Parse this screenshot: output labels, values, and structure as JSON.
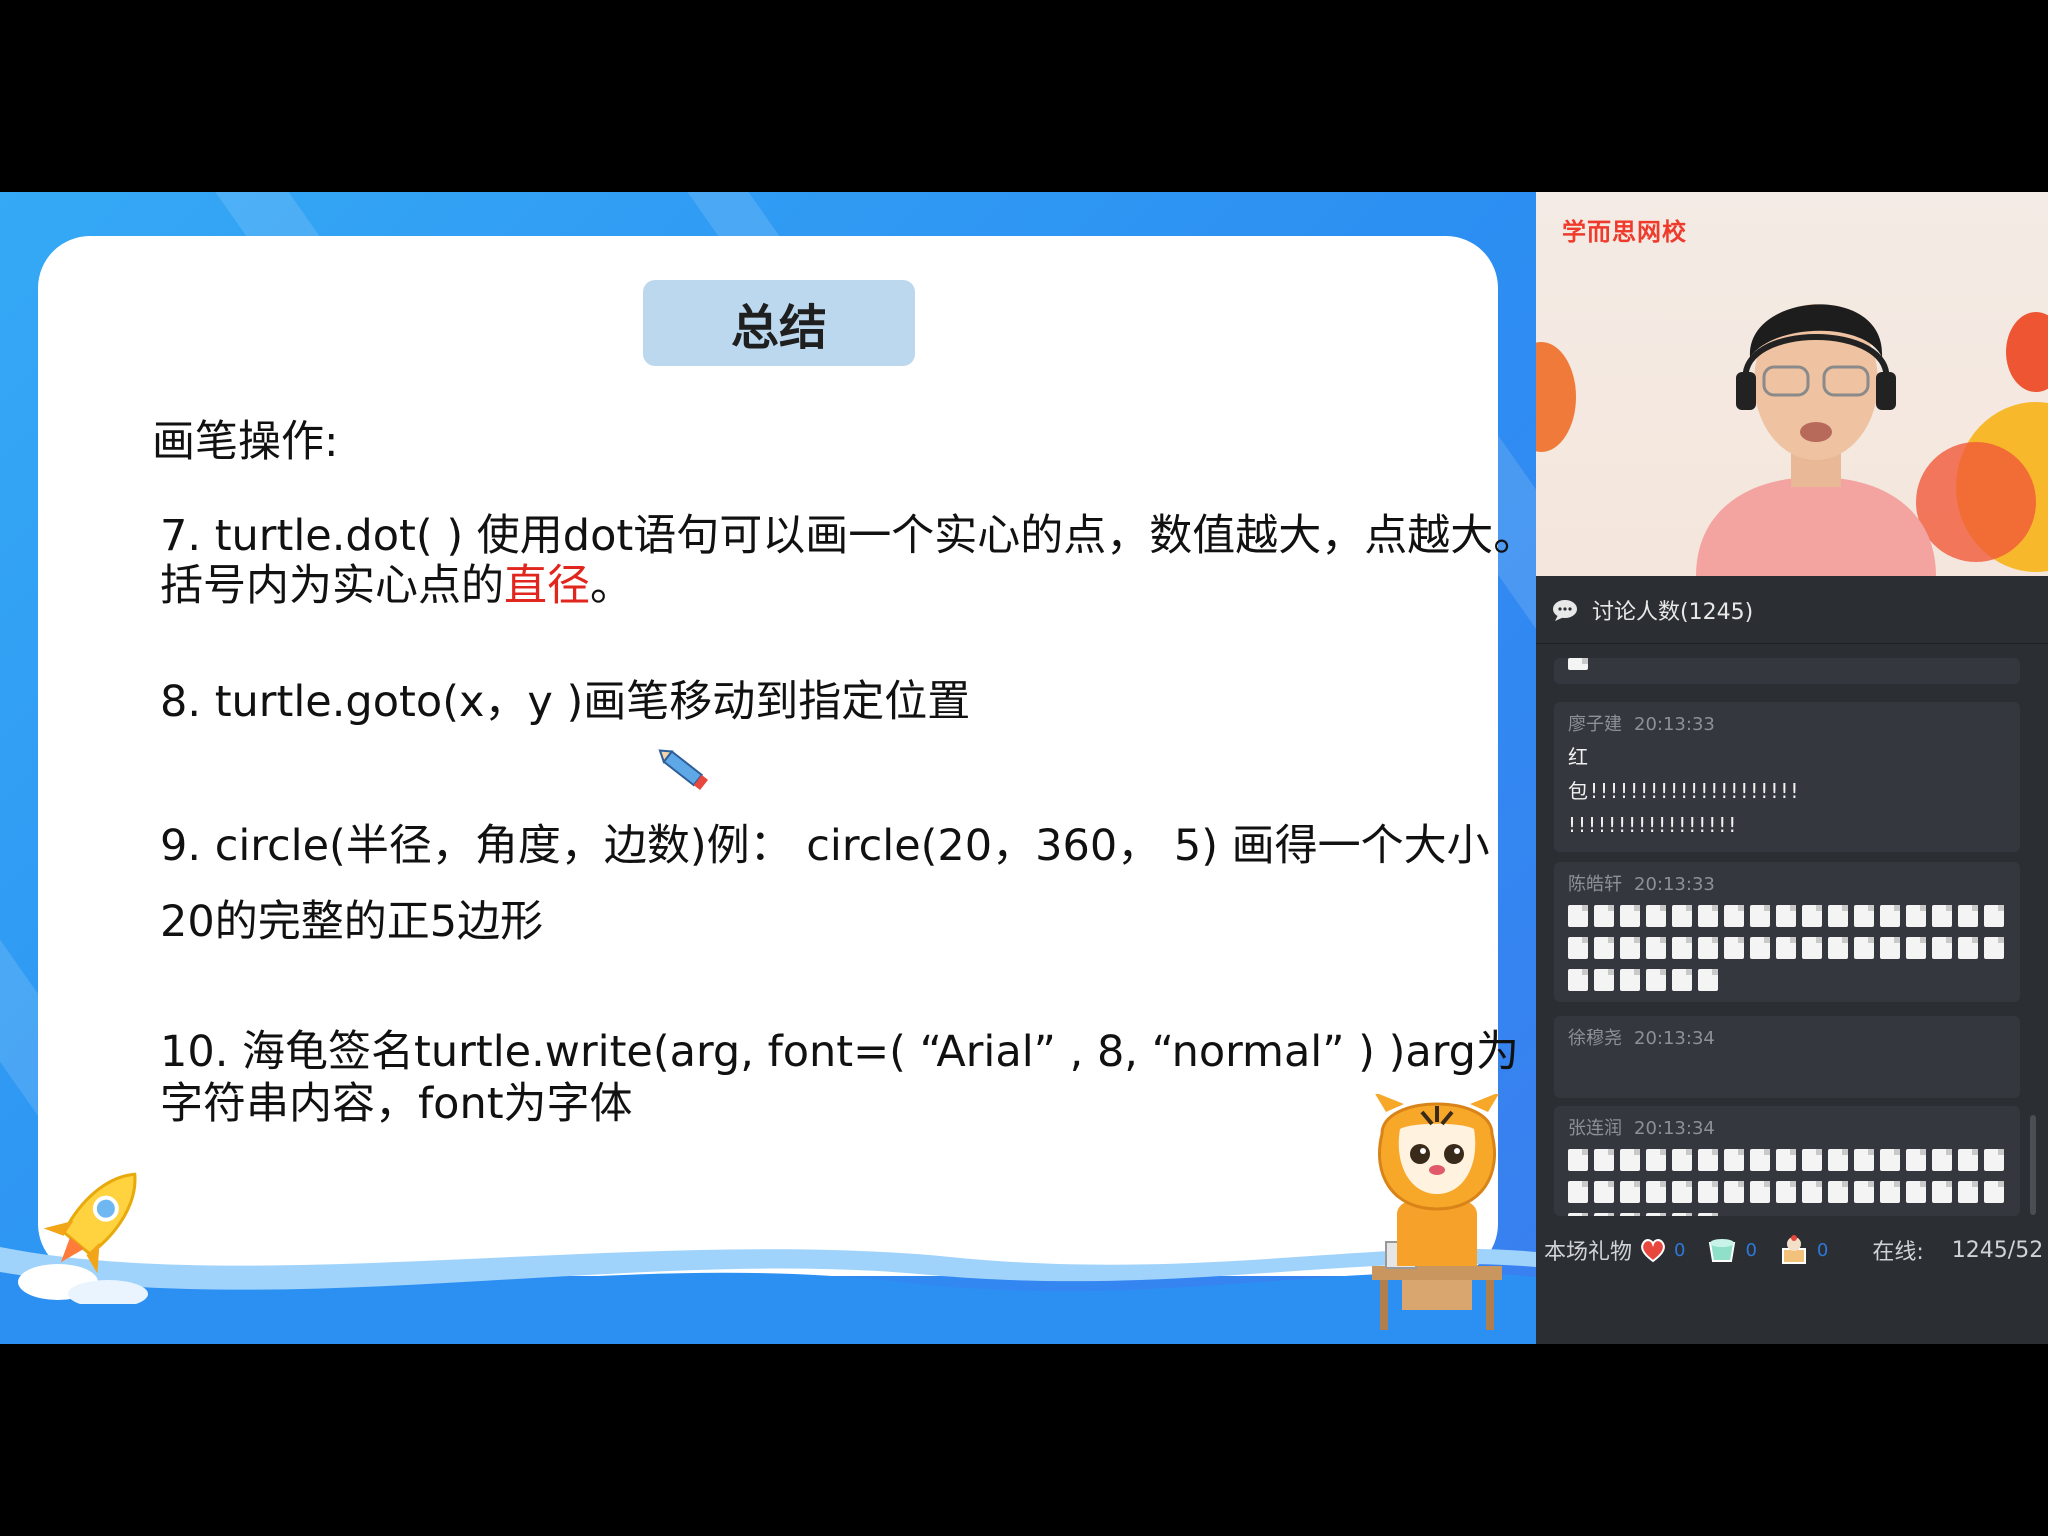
{
  "slide": {
    "title": "总结",
    "section": "画笔操作:",
    "item7_line1": "7. turtle.dot( ) 使用dot语句可以画一个实心的点，数值越大，点越大。",
    "item7_line2_pre": "括号内为实心点的",
    "item7_line2_red": "直径",
    "item7_line2_post": "。",
    "item8": "8. turtle.goto(x，y )画笔移动到指定位置",
    "item9_line1": "9. circle(半径，角度，边数)例：  circle(20，360，  5)  画得一个大小",
    "item9_line2": "20的完整的正5边形",
    "item10_line1": "10. 海龟签名turtle.write(arg, font=( “Arial” , 8, “normal” ) )arg为",
    "item10_line2": "字符串内容，font为字体"
  },
  "video": {
    "logo": "学而思网校"
  },
  "chat": {
    "header": "讨论人数(1245)",
    "messages": [
      {
        "name": "廖子建",
        "time": "20:13:33",
        "lines": [
          "红",
          "包!!!!!!!!!!!!!!!!!!!!!",
          "!!!!!!!!!!!!!!!!!"
        ]
      },
      {
        "name": "陈皓轩",
        "time": "20:13:33",
        "emoji_rows": [
          17,
          17,
          6
        ]
      },
      {
        "name": "徐穆尧",
        "time": "20:13:34"
      },
      {
        "name": "张连润",
        "time": "20:13:34",
        "emoji_rows": [
          17,
          17,
          6
        ]
      }
    ],
    "footer": {
      "gift_label": "本场礼物",
      "gift1_count": "0",
      "gift2_count": "0",
      "gift3_count": "0",
      "online_label": "在线:",
      "online_value": "1245/52"
    }
  },
  "colors": {
    "slide_bg": "#2c8ff2",
    "title_box": "#bcd8ef",
    "highlight_red": "#e0261d",
    "logo_red": "#ef3b2c",
    "chat_bg": "#2b2e33",
    "count_blue": "#2c79d8"
  },
  "icons": [
    "chat-bubble-icon",
    "pencil-icon",
    "rocket-icon",
    "tiger-mascot",
    "gift-icon"
  ]
}
